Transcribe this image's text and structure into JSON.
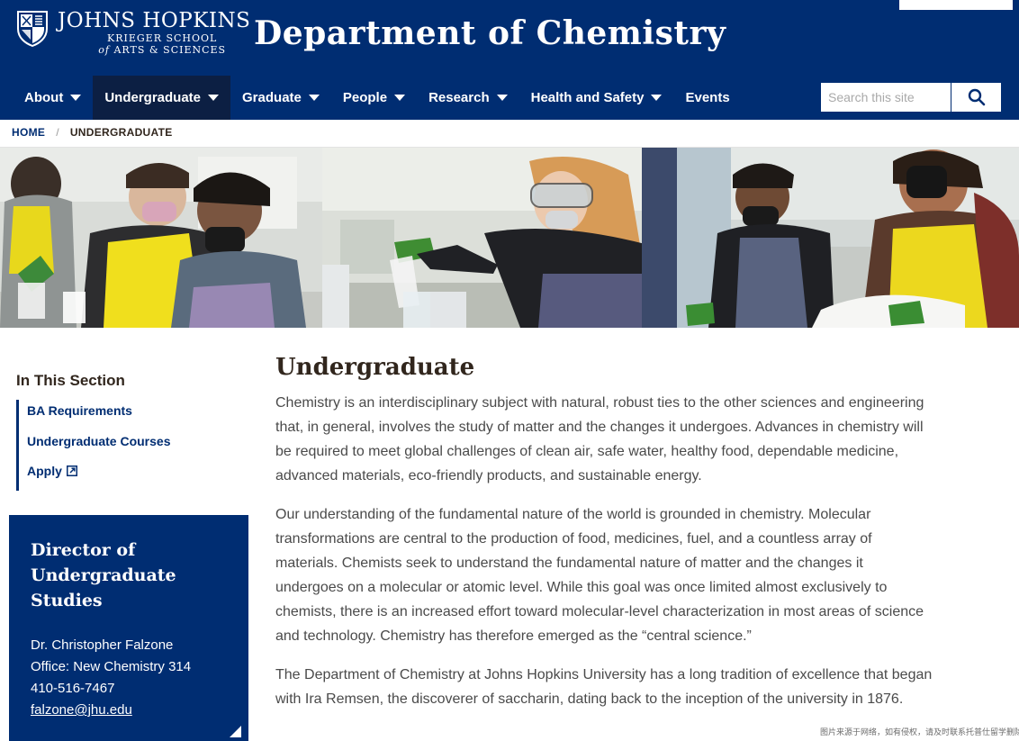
{
  "header": {
    "logo": {
      "main": "JOHNS HOPKINS",
      "sub1": "KRIEGER SCHOOL",
      "sub2_prefix": "of",
      "sub2": "ARTS & SCIENCES"
    },
    "department_title": "Department of Chemistry"
  },
  "nav": {
    "items": [
      {
        "label": "About",
        "has_dropdown": true
      },
      {
        "label": "Undergraduate",
        "has_dropdown": true,
        "active": true
      },
      {
        "label": "Graduate",
        "has_dropdown": true
      },
      {
        "label": "People",
        "has_dropdown": true
      },
      {
        "label": "Research",
        "has_dropdown": true
      },
      {
        "label": "Health and Safety",
        "has_dropdown": true
      },
      {
        "label": "Events",
        "has_dropdown": false
      }
    ]
  },
  "search": {
    "placeholder": "Search this site",
    "icon": "search-icon"
  },
  "breadcrumb": {
    "home": "HOME",
    "separator": "/",
    "current": "UNDERGRADUATE"
  },
  "sidebar": {
    "heading": "In This Section",
    "links": [
      {
        "label": "BA Requirements"
      },
      {
        "label": "Undergraduate Courses"
      },
      {
        "label": "Apply",
        "icon": "external-link-icon"
      }
    ]
  },
  "director": {
    "title": "Director of Undergraduate Studies",
    "name": "Dr. Christopher Falzone",
    "office": "Office: New Chemistry 314",
    "phone": "410-516-7467",
    "email": "falzone@jhu.edu"
  },
  "main": {
    "title": "Undergraduate",
    "paragraphs": [
      "Chemistry is an interdisciplinary subject with natural, robust ties to the other sciences and engineering that, in general, involves the study of matter and the changes it undergoes. Advances in chemistry will be required to meet global challenges of clean air, safe water, healthy food, dependable medicine, advanced materials, eco-friendly products, and sustainable energy.",
      "Our understanding of the fundamental nature of the world is grounded in chemistry. Molecular transformations are central to the production of food, medicines, fuel, and a countless array of materials. Chemists seek to understand the fundamental nature of matter and the changes it undergoes on a molecular or atomic level. While this goal was once limited almost exclusively to chemists, there is an increased effort toward molecular-level characterization in most areas of science and technology. Chemistry has therefore emerged as the “central science.”",
      "The Department of Chemistry at Johns Hopkins University has a long tradition of excellence that began with Ira Remsen, the discoverer of saccharin, dating back to the inception of the university in 1876."
    ]
  },
  "watermark": "图片来源于网络，如有侵权，请及时联系托普仕留学删除",
  "colors": {
    "brand_blue": "#002d72",
    "active_nav": "#0c1f43",
    "text_dark": "#31261d",
    "text_body": "#4a4a4a"
  }
}
